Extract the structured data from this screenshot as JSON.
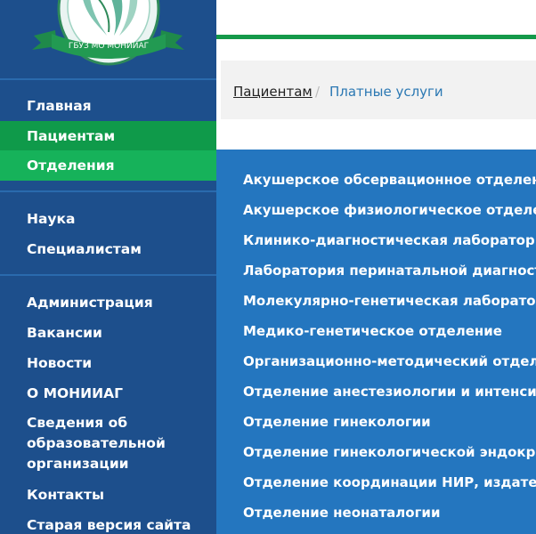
{
  "logo": {
    "ribbon_text": "ГБУЗ МО МОНИИАГ"
  },
  "breadcrumb": {
    "parent": "Пациентам",
    "separator": "/",
    "current": "Платные услуги"
  },
  "sidebar": {
    "group1": [
      "Главная",
      "Пациентам",
      "Отделения"
    ],
    "group2": [
      "Наука",
      "Специалистам"
    ],
    "group3": [
      "Администрация",
      "Вакансии",
      "Новости",
      "О МОНИИАГ",
      "Сведения об образовательной организации",
      "Контакты",
      "Старая версия сайта"
    ]
  },
  "departments": [
    "Акушерское обсервационное отделени",
    "Акушерское физиологическое отделени",
    "Клинико-диагностическая лаборатори",
    "Лаборатория перинатальной диагност",
    "Молекулярно-генетическая лаборатор",
    "Медико-генетическое отделение",
    "Организационно-методический отдел",
    "Отделение анестезиологии и интенсив",
    "Отделение гинекологии",
    "Отделение гинекологической эндокри",
    "Отделение координации НИР, издател",
    "Отделение неонаталогии"
  ],
  "colors": {
    "sidebar": "#1d4f8c",
    "active_dark": "#0f9a4a",
    "active_light": "#16b25a",
    "dropdown": "#2476bf",
    "accent_green": "#14994a"
  }
}
